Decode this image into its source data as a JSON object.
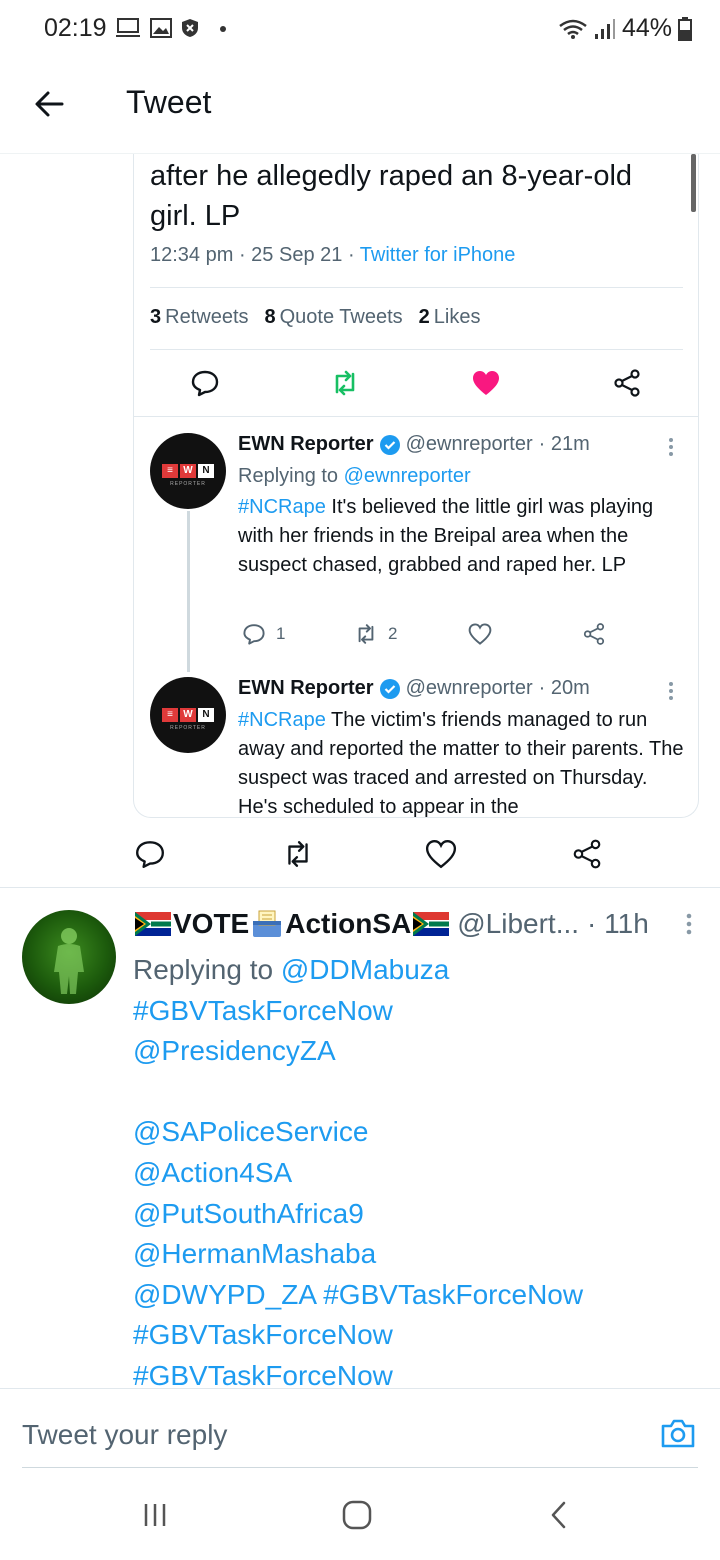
{
  "status_bar": {
    "time": "02:19",
    "battery": "44%",
    "icons": [
      "screen-icon",
      "gallery-icon",
      "shield-icon",
      "dot-icon",
      "wifi-icon",
      "signal-icon",
      "battery-icon"
    ]
  },
  "header": {
    "title": "Tweet"
  },
  "focused_tweet": {
    "text": "after he allegedly raped an 8-year-old girl. LP",
    "time": "12:34 pm",
    "date": "25 Sep 21",
    "source": "Twitter for iPhone",
    "stats": [
      {
        "count": "3",
        "label": "Retweets"
      },
      {
        "count": "8",
        "label": "Quote Tweets"
      },
      {
        "count": "2",
        "label": "Likes"
      }
    ],
    "liked": true,
    "accent_green": "#17bf63",
    "accent_like": "#f91880"
  },
  "replies": [
    {
      "name": "EWN Reporter",
      "handle": "@ewnreporter",
      "time": "· 21m",
      "replying_prefix": "Replying to",
      "replying_to": "@ewnreporter",
      "hashtag": "#NCRape",
      "text": " It's believed the little girl was playing with her friends in the Breipal area when the suspect chased, grabbed and raped her. LP",
      "replies_count": "1",
      "retweets_count": "2"
    },
    {
      "name": "EWN Reporter",
      "handle": "@ewnreporter",
      "time": "· 20m",
      "hashtag": "#NCRape",
      "text": " The victim's friends managed to run away and reported the matter to their parents. The suspect was traced and arrested on Thursday. He's scheduled to appear in the"
    }
  ],
  "second_tweet": {
    "name_part1": "VOTE",
    "name_part2": "ActionSA",
    "handle": "@Libert...",
    "time": "· 11h",
    "replying_prefix": "Replying to",
    "replying_to": "@DDMabuza",
    "lines": [
      "#GBVTaskForceNow",
      "@PresidencyZA",
      "",
      "@SAPoliceService",
      "@Action4SA",
      "@PutSouthAfrica9",
      "@HermanMashaba",
      "@DWYPD_ZA #GBVTaskForceNow",
      "#GBVTaskForceNow",
      "#GBVTaskForceNow"
    ]
  },
  "reply_bar": {
    "placeholder": "Tweet your reply"
  },
  "nav": {
    "icons": [
      "recent-apps-icon",
      "home-icon",
      "back-nav-icon"
    ]
  }
}
